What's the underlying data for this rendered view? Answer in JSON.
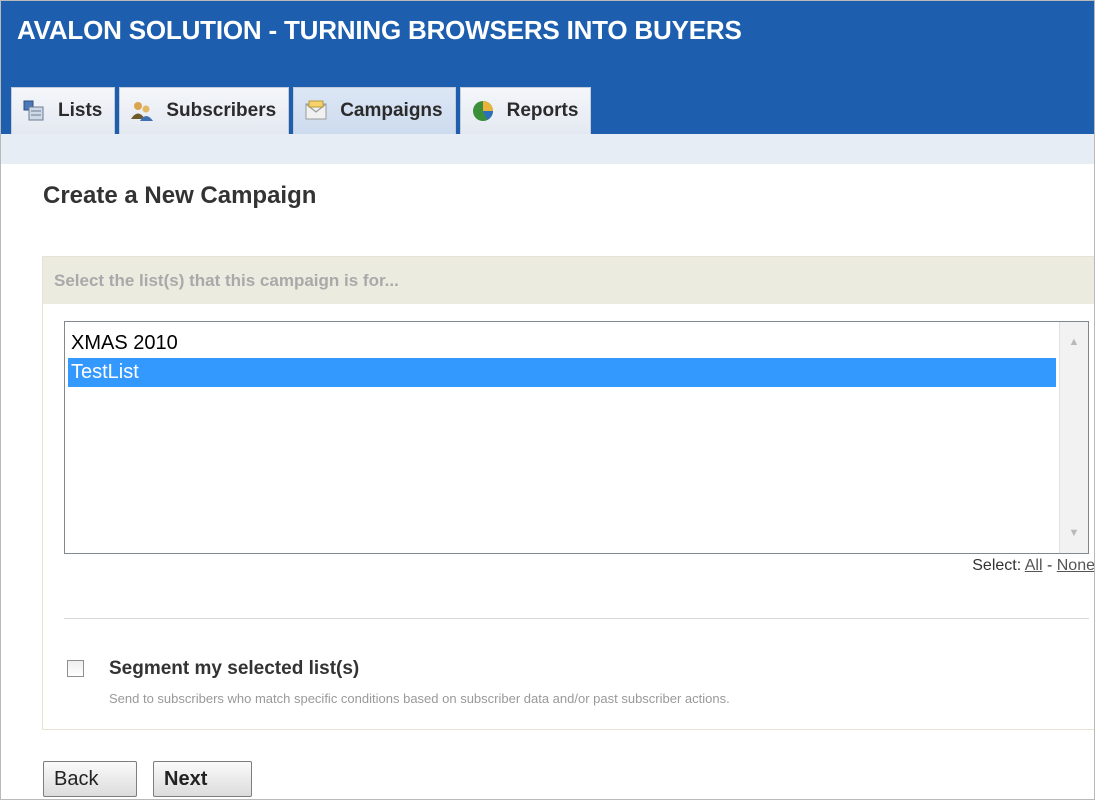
{
  "app": {
    "title": "AVALON SOLUTION - TURNING BROWSERS INTO BUYERS"
  },
  "tabs": [
    {
      "label": "Lists",
      "icon": "lists-icon",
      "active": false
    },
    {
      "label": "Subscribers",
      "icon": "subscribers-icon",
      "active": false
    },
    {
      "label": "Campaigns",
      "icon": "campaigns-icon",
      "active": true
    },
    {
      "label": "Reports",
      "icon": "reports-icon",
      "active": false
    }
  ],
  "page": {
    "title": "Create a New Campaign"
  },
  "list_select": {
    "prompt": "Select the list(s) that this campaign is for...",
    "items": [
      {
        "label": "XMAS 2010",
        "selected": false
      },
      {
        "label": "TestList",
        "selected": true
      }
    ],
    "select_prefix": "Select:",
    "select_all": "All",
    "separator": "-",
    "select_none": "None"
  },
  "segment": {
    "label": "Segment my selected list(s)",
    "description": "Send to subscribers who match specific conditions based on subscriber data and/or past subscriber actions.",
    "checked": false
  },
  "buttons": {
    "back": "Back",
    "next": "Next"
  },
  "colors": {
    "header_bg": "#1d5fae",
    "selection": "#3399ff",
    "panel_header_bg": "#ecebe0"
  }
}
